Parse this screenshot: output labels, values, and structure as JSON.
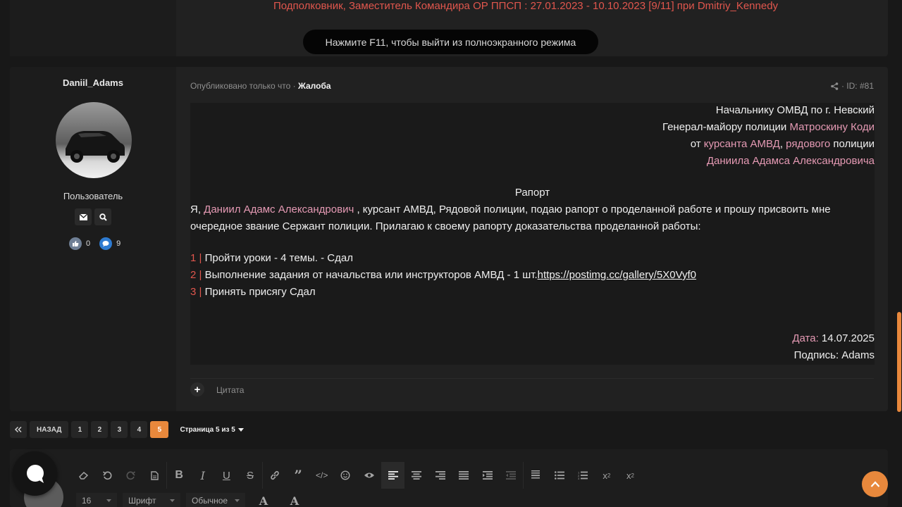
{
  "previous_post": {
    "signature": "Подполковник, Заместитель Командира ОР ППСП : 27.01.2023 - 10.10.2023 [9/11] при Dmitriy_Kennedy"
  },
  "fullscreen_toast": "Нажмите F11, чтобы выйти из полноэкранного режима",
  "post": {
    "author": {
      "username": "Daniil_Adams",
      "role": "Пользователь",
      "likes": "0",
      "messages": "9"
    },
    "meta": {
      "published": "Опубликовано только что",
      "separator": "·",
      "category": "Жалоба",
      "id": "· ID: #81"
    },
    "header": {
      "line1": "Начальнику ОМВД по г. Невский",
      "line2_prefix": "Генерал-майору полиции ",
      "line2_name": "Матроскину Коди",
      "line3_from": "от ",
      "line3_rank": "курсанта АМВД",
      "line3_comma": ", ",
      "line3_rank2": "рядового",
      "line3_suffix": " полиции",
      "line4": "Даниила Адамса Александровича"
    },
    "title": "Рапорт",
    "para": {
      "p1_a": "Я, ",
      "p1_name": "Даниил Адамс Александрович",
      "p1_b": " , курсант АМВД, Рядовой полиции, подаю рапорт о проделанной работе и прошу присвоить мне",
      "p2": "очередное звание Сержант полиции. Прилагаю к своему рапорту доказательства проделанной работы:"
    },
    "items": [
      {
        "num": "1 |",
        "text": " Пройти уроки - 4 темы. - Сдал"
      },
      {
        "num": "2 |",
        "text": " Выполнение задания от начальства или инструкторов АМВД - 1 шт.",
        "link": "https://postimg.cc/gallery/5X0Vyf0"
      },
      {
        "num": "3 |",
        "text": " Принять присягу Сдал"
      }
    ],
    "footer": {
      "date_label": "Дата:",
      "date_value": " 14.07.2025",
      "sign": "Подпись: Adams"
    },
    "quote_label": "Цитата"
  },
  "pagination": {
    "back": "НАЗАД",
    "pages": [
      "1",
      "2",
      "3",
      "4",
      "5"
    ],
    "current": "5",
    "page_of": "Страница 5 из 5"
  },
  "editor": {
    "font_size": "16",
    "font": "Шрифт",
    "style": "Обычное"
  },
  "colors": {
    "accent": "#e8883c",
    "link_pink": "#e59ab4",
    "red": "#e0564d"
  }
}
